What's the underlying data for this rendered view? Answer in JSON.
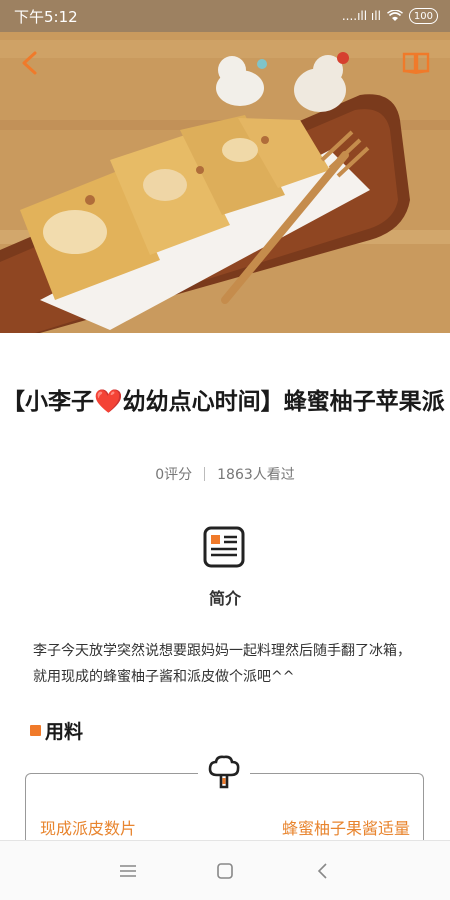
{
  "status_bar": {
    "time": "下午5:12",
    "signal_text": "....ıll ıll",
    "battery": "100"
  },
  "hero": {
    "image_desc_icon": "photo",
    "back_icon": "back-arrow-icon",
    "book_icon": "book-icon"
  },
  "recipe": {
    "title_part1": "【小李子",
    "title_heart": "❤️",
    "title_part2": "幼幼点心时间】蜂蜜柚子苹果派",
    "rating": "0评分",
    "views": "1863人看过"
  },
  "intro": {
    "heading": "简介",
    "text": "李子今天放学突然说想要跟妈妈一起料理然后随手翻了冰箱，就用现成的蜂蜜柚子酱和派皮做个派吧^^"
  },
  "ingredients": {
    "heading": "用料",
    "items": [
      {
        "name": "现成派皮数片",
        "amount": "蜂蜜柚子果酱适量"
      }
    ]
  },
  "colors": {
    "accent": "#f07a2a",
    "ingredient_text": "#e8852f"
  }
}
